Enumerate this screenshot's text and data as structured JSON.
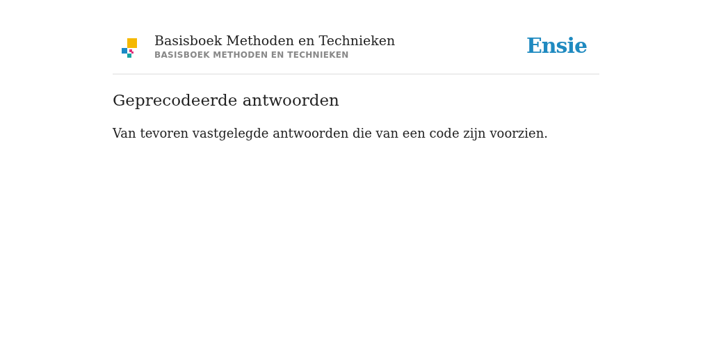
{
  "header": {
    "book_title": "Basisboek Methoden en Technieken",
    "book_subtitle": "BASISBOEK METHODEN EN TECHNIEKEN",
    "brand": "Ensie"
  },
  "entry": {
    "term": "Geprecodeerde antwoorden",
    "definition": "Van tevoren vastgelegde antwoorden die van een code zijn voorzien."
  }
}
